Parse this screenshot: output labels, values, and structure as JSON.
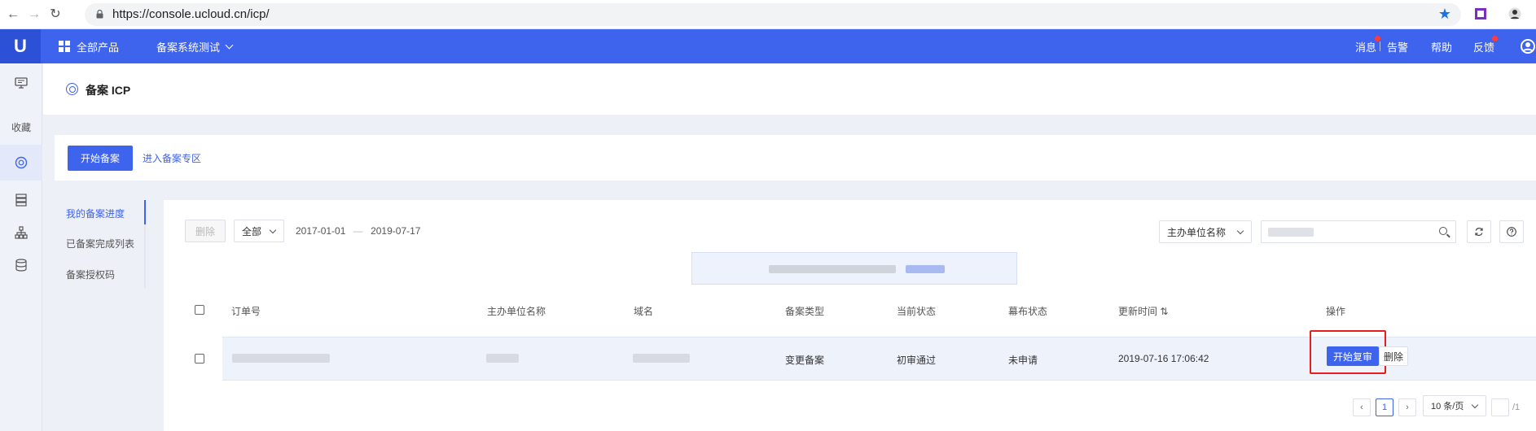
{
  "browser": {
    "url": "https://console.ucloud.cn/icp/",
    "back_icon": "arrow-left",
    "forward_icon": "arrow-right",
    "reload_icon": "reload",
    "lock_icon": "lock",
    "star_icon": "star"
  },
  "header": {
    "logo": "U",
    "all_products": "全部产品",
    "project": "备案系统测试",
    "messages": "消息",
    "alerts": "告警",
    "help": "帮助",
    "feedback": "反馈",
    "accent": "#3e63ec"
  },
  "rail": {
    "favorites": "收藏"
  },
  "page": {
    "title": "备案 ICP"
  },
  "actions": {
    "start_filing": "开始备案",
    "enter_zone": "进入备案专区"
  },
  "subnav": {
    "items": [
      "我的备案进度",
      "已备案完成列表",
      "备案授权码"
    ]
  },
  "toolbar": {
    "delete": "删除",
    "status_filter": "全部",
    "date_start": "2017-01-01",
    "date_sep": "—",
    "date_end": "2019-07-17",
    "search_field": "主办单位名称"
  },
  "table": {
    "headers": [
      "订单号",
      "主办单位名称",
      "域名",
      "备案类型",
      "当前状态",
      "幕布状态",
      "更新时间",
      "操作"
    ],
    "sort_indicator": "⇅",
    "rows": [
      {
        "type": "变更备案",
        "status": "初审通过",
        "curtain": "未申请",
        "updated": "2019-07-16 17:06:42",
        "action_primary": "开始复审",
        "action_delete": "删除"
      }
    ]
  },
  "pagination": {
    "prev": "‹",
    "current": "1",
    "next": "›",
    "page_size": "10 条/页",
    "total": "/1"
  }
}
